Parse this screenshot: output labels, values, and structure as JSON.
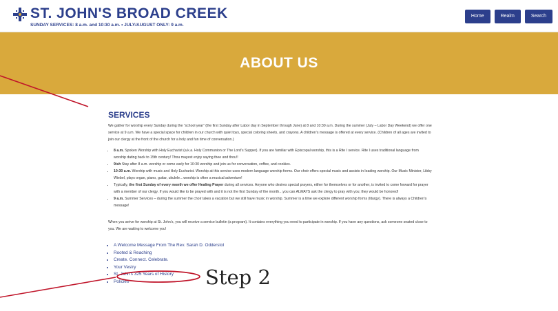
{
  "header": {
    "brand": "ST. JOHN'S BROAD CREEK",
    "tagline": "SUNDAY SERVICES: 8 a.m. and 10:30 a.m. • JULY/AUGUST ONLY: 9 a.m.",
    "nav": [
      "Home",
      "Realm",
      "Search"
    ]
  },
  "hero": {
    "title": "ABOUT US"
  },
  "services": {
    "title": "SERVICES",
    "intro": "We gather for worship every Sunday during the “school year” (the first Sunday after Labor day in September through June) at 8 and 10:30 a.m. During the summer (July – Labor Day Weekend) we offer one service at 9 a.m. We have a special space for children in our church with quiet toys, special coloring sheets, and crayons. A children’s message is offered at every service. (Children of all ages are invited to join our clergy at the front of the church for a holy and fun time of conversation.)",
    "items": [
      {
        "strong": "8 a.m.",
        "text": " Spoken Worship with Holy Eucharist (a.k.a. Holy Communion or The Lord’s Supper). If you are familiar with Episcopal worship, this is a Rite I service. Rite I uses traditional language from worship dating back to 15th century! Thou mayest enjoy saying thee and thou!!"
      },
      {
        "strong": "9ish",
        "text": " Stay after 8 a.m. worship or come early for 10:30 worship and join us for conversation, coffee, and cookies."
      },
      {
        "strong": "10:30 a.m.",
        "text": " Worship with music and Holy Eucharist. Worship at this service uses modern language worship forms. Our choir offers special music and assists in leading worship. Our Music Minister, Libby Wiebel, plays organ, piano, guitar, ukulele…worship is often a musical adventure!"
      },
      {
        "pre": "Typically, ",
        "strong": "the first Sunday of every month we offer Healing Prayer",
        "text": " during all services. Anyone who desires special prayers, either for themselves or for another, is invited to come forward for prayer with a member of our clergy. If you would like to be prayed with and it is not the first Sunday of the month…you can ALWAYS ask the clergy to pray with you; they would be honored!"
      },
      {
        "strong": "9 a.m.",
        "text": " Summer Services – during the summer the choir takes a vacation but we still have music in worship. Summer is a time we explore different worship forms (liturgy). There is always a Children’s message!"
      }
    ],
    "bulletin": "When you arrive for worship at St. John’s, you will receive a service bulletin (a program). It contains everything you need to participate in worship. If you have any questions, ask someone seated close to you. We are waiting to welcome you!"
  },
  "links": [
    "A Welcome Message From The Rev. Sarah D. Odderstol",
    "Rooted & Reaching",
    "Create. Connect. Celebrate.",
    "Your Vestry",
    "St. John’s 325 Years of History",
    "Policies"
  ],
  "annotation": {
    "step_label": "Step 2",
    "color": "#c0152a"
  },
  "colors": {
    "brand": "#2c3f8c",
    "hero": "#d9a93c"
  }
}
